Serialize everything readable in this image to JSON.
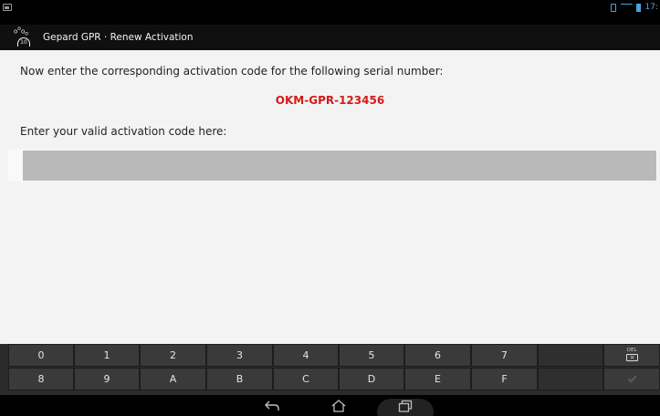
{
  "status_bar": {
    "time": "17:"
  },
  "app_bar": {
    "title": "Gepard GPR · Renew Activation",
    "logo_text": "10"
  },
  "content": {
    "instruction": "Now enter the corresponding activation code for the following serial number:",
    "serial_number": "OKM-GPR-123456",
    "prompt": "Enter your valid activation code here:",
    "code_value": ""
  },
  "keyboard": {
    "row1": [
      "0",
      "1",
      "2",
      "3",
      "4",
      "5",
      "6",
      "7",
      "",
      ""
    ],
    "row2": [
      "8",
      "9",
      "A",
      "B",
      "C",
      "D",
      "E",
      "F",
      "",
      ""
    ],
    "del_label": "DEL",
    "colors": {
      "key": "#3a3a3a",
      "text": "#e4e4e4"
    }
  },
  "colors": {
    "serial": "#d41a1a",
    "accent": "#4ba3d6"
  },
  "icons": {
    "back": "back-icon",
    "home": "home-icon",
    "recent": "recent-apps-icon",
    "delete": "backspace-icon",
    "done": "check-icon"
  }
}
